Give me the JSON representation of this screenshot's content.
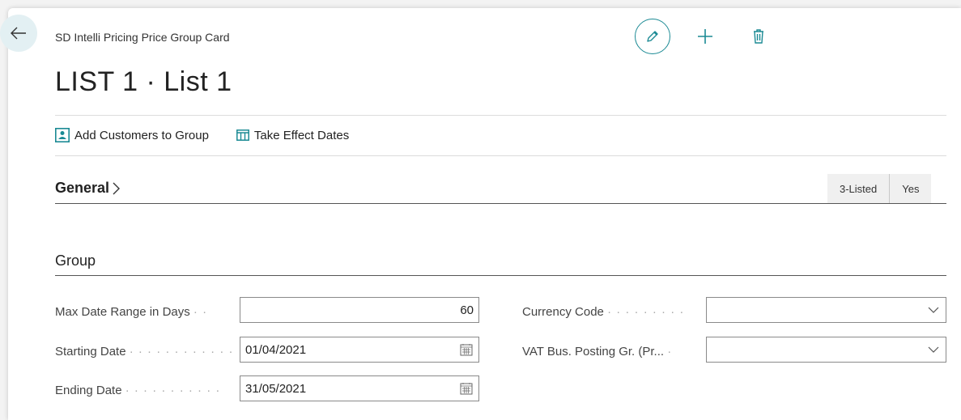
{
  "header": {
    "breadcrumb": "SD Intelli Pricing Price Group Card",
    "title": "LIST 1 · List 1"
  },
  "actions": [
    {
      "label": "Add Customers to Group",
      "icon": "user-group-icon"
    },
    {
      "label": "Take Effect Dates",
      "icon": "table-icon"
    }
  ],
  "general": {
    "title": "General",
    "badges": [
      "3-Listed",
      "Yes"
    ]
  },
  "group": {
    "title": "Group",
    "max_date_range": {
      "label": "Max Date Range in Days",
      "value": "60"
    },
    "starting_date": {
      "label": "Starting Date",
      "value": "01/04/2021"
    },
    "ending_date": {
      "label": "Ending Date",
      "value": "31/05/2021"
    },
    "currency_code": {
      "label": "Currency Code",
      "value": ""
    },
    "vat_bus_posting": {
      "label": "VAT Bus. Posting Gr. (Pr...",
      "value": ""
    }
  },
  "colors": {
    "accent": "#1b8a94",
    "back_bg": "#e3f0f3"
  }
}
